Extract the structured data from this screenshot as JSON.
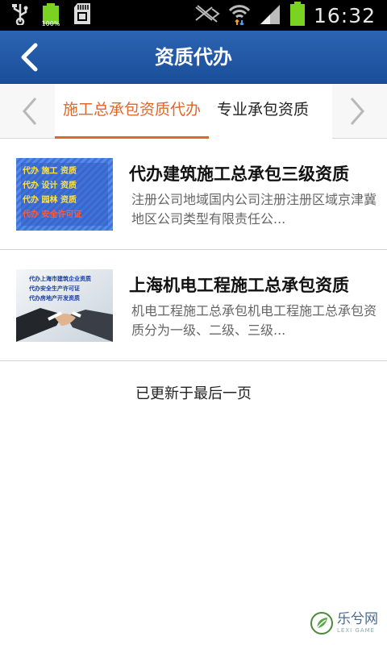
{
  "status_bar": {
    "time": "16:32",
    "battery_label": "100%",
    "icons": [
      "usb-icon",
      "battery-small-icon",
      "sd-card-icon",
      "mute-icon",
      "wifi-icon",
      "signal-icon",
      "battery-icon"
    ],
    "colors": {
      "battery": "#7bd321"
    }
  },
  "appbar": {
    "title": "资质代办",
    "back_icon": "chevron-left-icon",
    "color": "#1f5aa8"
  },
  "tabs": {
    "items": [
      {
        "label": "施工总承包资质代办",
        "active": true
      },
      {
        "label": "专业承包资质",
        "active": false
      }
    ],
    "active_color": "#e0672a"
  },
  "list": {
    "items": [
      {
        "title": "代办建筑施工总承包三级资质",
        "description": "注册公司地域国内公司注册注册区域京津冀地区公司类型有限责任公...",
        "thumb_lines": [
          "代办 施工 资质",
          "代办 设计 资质",
          "代办 园林 资质",
          "代办 安全许可证"
        ]
      },
      {
        "title": "上海机电工程施工总承包资质",
        "description": "机电工程施工总承包机电工程施工总承包资质分为一级、二级、三级...",
        "thumb_lines": [
          "代办上海市建筑企业资质",
          "代办安全生产许可证",
          "代办房地产开发资质"
        ]
      }
    ]
  },
  "footer": {
    "text": "已更新于最后一页"
  },
  "watermark": {
    "cn": "乐兮网",
    "en": "LEXI GAME"
  }
}
